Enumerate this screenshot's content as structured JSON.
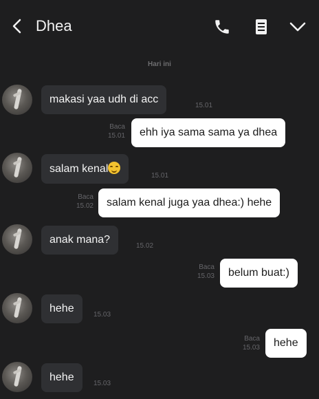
{
  "header": {
    "contact_name": "Dhea",
    "icons": [
      "back-icon",
      "phone-icon",
      "notes-icon",
      "chevron-down-icon"
    ]
  },
  "date_separator": "Hari ini",
  "messages": [
    {
      "direction": "in",
      "text": "makasi yaa udh di acc",
      "time": "15.01"
    },
    {
      "direction": "out",
      "text": "ehh iya sama sama ya dhea",
      "read": "Baca",
      "time": "15.01"
    },
    {
      "direction": "in",
      "text": "salam kenal",
      "emoji": "smiling-face-emoji",
      "time": "15.01"
    },
    {
      "direction": "out",
      "text": "salam kenal juga yaa dhea:) hehe",
      "read": "Baca",
      "time": "15.02"
    },
    {
      "direction": "in",
      "text": "anak mana?",
      "time": "15.02"
    },
    {
      "direction": "out",
      "text": "belum buat:)",
      "read": "Baca",
      "time": "15.03"
    },
    {
      "direction": "in",
      "text": "hehe",
      "time": "15.03"
    },
    {
      "direction": "out",
      "text": "hehe",
      "read": "Baca",
      "time": "15.03"
    },
    {
      "direction": "in",
      "text": "hehe",
      "time": "15.03"
    }
  ],
  "colors": {
    "background": "#1e1e1f",
    "incoming_bubble": "#2f3033",
    "outgoing_bubble": "#ffffff",
    "meta_text": "#66666a"
  }
}
